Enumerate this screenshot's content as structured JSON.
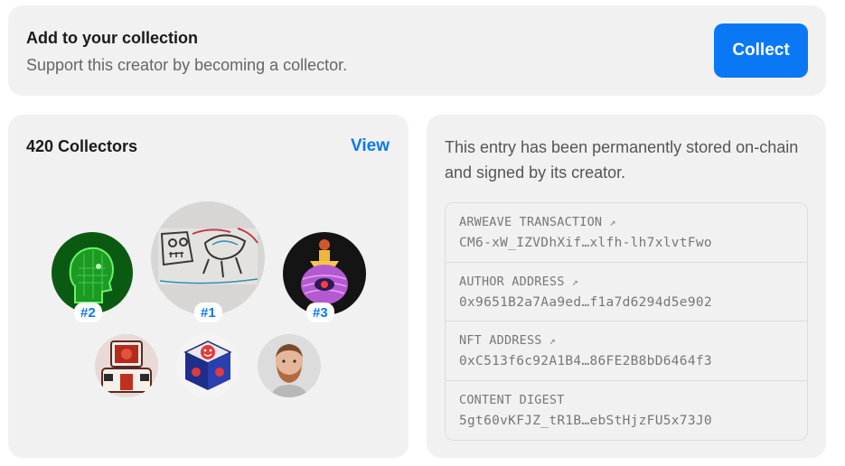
{
  "collect": {
    "title": "Add to your collection",
    "subtitle": "Support this creator by becoming a collector.",
    "button_label": "Collect"
  },
  "collectors": {
    "count_label": "420 Collectors",
    "view_label": "View",
    "ranks": [
      "#1",
      "#2",
      "#3"
    ],
    "avatars": [
      {
        "icon": "sketch-drawing-avatar"
      },
      {
        "icon": "green-head-avatar"
      },
      {
        "icon": "potion-bottle-avatar"
      },
      {
        "icon": "robot-avatar"
      },
      {
        "icon": "smiley-cube-avatar"
      },
      {
        "icon": "bearded-man-avatar"
      }
    ]
  },
  "provenance": {
    "description": "This entry has been permanently stored on-chain and signed by its creator.",
    "items": [
      {
        "label": "ARWEAVE TRANSACTION",
        "value": "CM6-xW_IZVDhXif…xlfh-lh7xlvtFwo",
        "icon": "external-link-icon"
      },
      {
        "label": "AUTHOR ADDRESS",
        "value": "0x9651B2a7Aa9ed…f1a7d6294d5e902",
        "icon": "external-link-icon"
      },
      {
        "label": "NFT ADDRESS",
        "value": "0xC513f6c92A1B4…86FE2B8bD6464f3",
        "icon": "external-link-icon"
      },
      {
        "label": "CONTENT DIGEST",
        "value": "5gt60vKFJZ_tR1B…ebStHjzFU5x73J0"
      }
    ]
  },
  "colors": {
    "accent": "#0a78f5",
    "card_bg": "#f1f1f1"
  }
}
